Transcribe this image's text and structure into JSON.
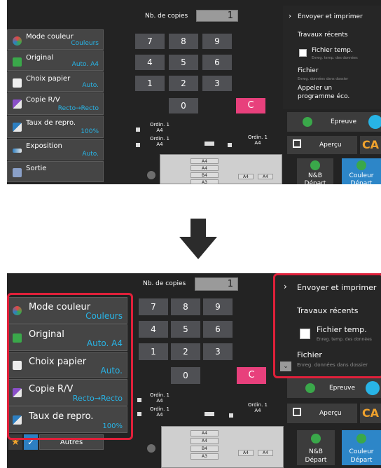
{
  "colors": {
    "accent_blue": "#28b4e6",
    "clear_pink": "#e8407c",
    "highlight_red": "#e0203a",
    "ca_orange": "#f0a22d",
    "green": "#3aa84a"
  },
  "left_panel": {
    "items": [
      {
        "label": "Mode couleur",
        "value": "Couleurs",
        "icon": "color-mode-icon"
      },
      {
        "label": "Original",
        "value": "Auto. A4",
        "icon": "original-icon"
      },
      {
        "label": "Choix papier",
        "value": "Auto.",
        "icon": "paper-select-icon"
      },
      {
        "label": "Copie R/V",
        "value": "Recto→Recto",
        "icon": "duplex-icon"
      },
      {
        "label": "Taux de repro.",
        "value": "100%",
        "icon": "zoom-ratio-icon"
      },
      {
        "label": "Exposition",
        "value": "Auto.",
        "icon": "exposure-icon"
      },
      {
        "label": "Sortie",
        "value": "",
        "icon": "output-icon"
      }
    ],
    "autres_label": "Autres"
  },
  "copies": {
    "label": "Nb. de copies",
    "value": "1",
    "keys": [
      "7",
      "8",
      "9",
      "4",
      "5",
      "6",
      "1",
      "2",
      "3",
      "0"
    ],
    "clear_label": "C"
  },
  "diagram": {
    "ordin_label": "Ordin. 1",
    "size_label": "A4",
    "tray_sizes": [
      "A4",
      "A4",
      "B4",
      "A3",
      "A4",
      "A4"
    ]
  },
  "right_panel": {
    "send_print": "Envoyer et imprimer",
    "recent_jobs": "Travaux récents",
    "temp_file": "Fichier temp.",
    "temp_file_sub": "Enreg. temp. des données",
    "file": "Fichier",
    "file_sub": "Enreg. données dans dossier",
    "eco_program": "Appeler un programme éco.",
    "epreuve": "Epreuve",
    "apercu": "Aperçu",
    "ca": "CA",
    "nb_start_1": "N&B",
    "nb_start_2": "Départ",
    "color_start_1": "Couleur",
    "color_start_2": "Départ"
  }
}
